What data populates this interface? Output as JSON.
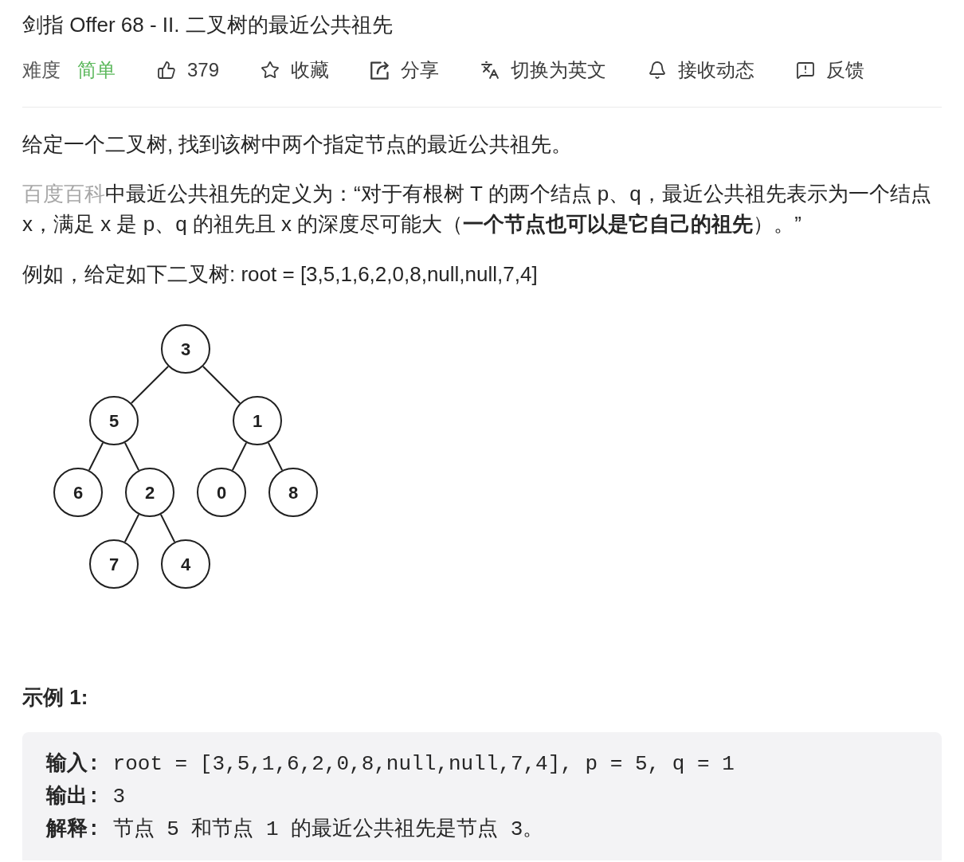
{
  "title": "剑指 Offer 68 - II. 二叉树的最近公共祖先",
  "meta": {
    "difficulty_label": "难度",
    "difficulty": "简单",
    "actions": [
      {
        "kind": "like",
        "label": "379"
      },
      {
        "kind": "favorite",
        "label": "收藏"
      },
      {
        "kind": "share",
        "label": "分享"
      },
      {
        "kind": "translate",
        "label": "切换为英文"
      },
      {
        "kind": "subscribe",
        "label": "接收动态"
      },
      {
        "kind": "feedback",
        "label": "反馈"
      }
    ]
  },
  "description": {
    "intro": "给定一个二叉树, 找到该树中两个指定节点的最近公共祖先。",
    "definition": {
      "link": "百度百科",
      "text": "中最近公共祖先的定义为：“对于有根树 T 的两个结点 p、q，最近公共祖先表示为一个结点 x，满足 x 是 p、q 的祖先且 x 的深度尽可能大（**一个节点也可以是它自己的祖先**）。”"
    },
    "example_intro": "例如，给定如下二叉树: root = [3,5,1,6,2,0,8,null,null,7,4]"
  },
  "tree": {
    "value": "3",
    "children": [
      {
        "value": "5",
        "children": [
          {
            "value": "6"
          },
          {
            "value": "2",
            "children": [
              {
                "value": "7"
              },
              {
                "value": "4"
              }
            ]
          }
        ]
      },
      {
        "value": "1",
        "children": [
          {
            "value": "0"
          },
          {
            "value": "8"
          }
        ]
      }
    ]
  },
  "example": {
    "heading": "示例 1:",
    "lines": [
      {
        "label": "输入:",
        "text": "root = [3,5,1,6,2,0,8,null,null,7,4], p = 5, q = 1"
      },
      {
        "label": "输出:",
        "text": "3"
      },
      {
        "label": "解释:",
        "text": "节点 5 和节点 1 的最近公共祖先是节点 3。"
      }
    ]
  }
}
